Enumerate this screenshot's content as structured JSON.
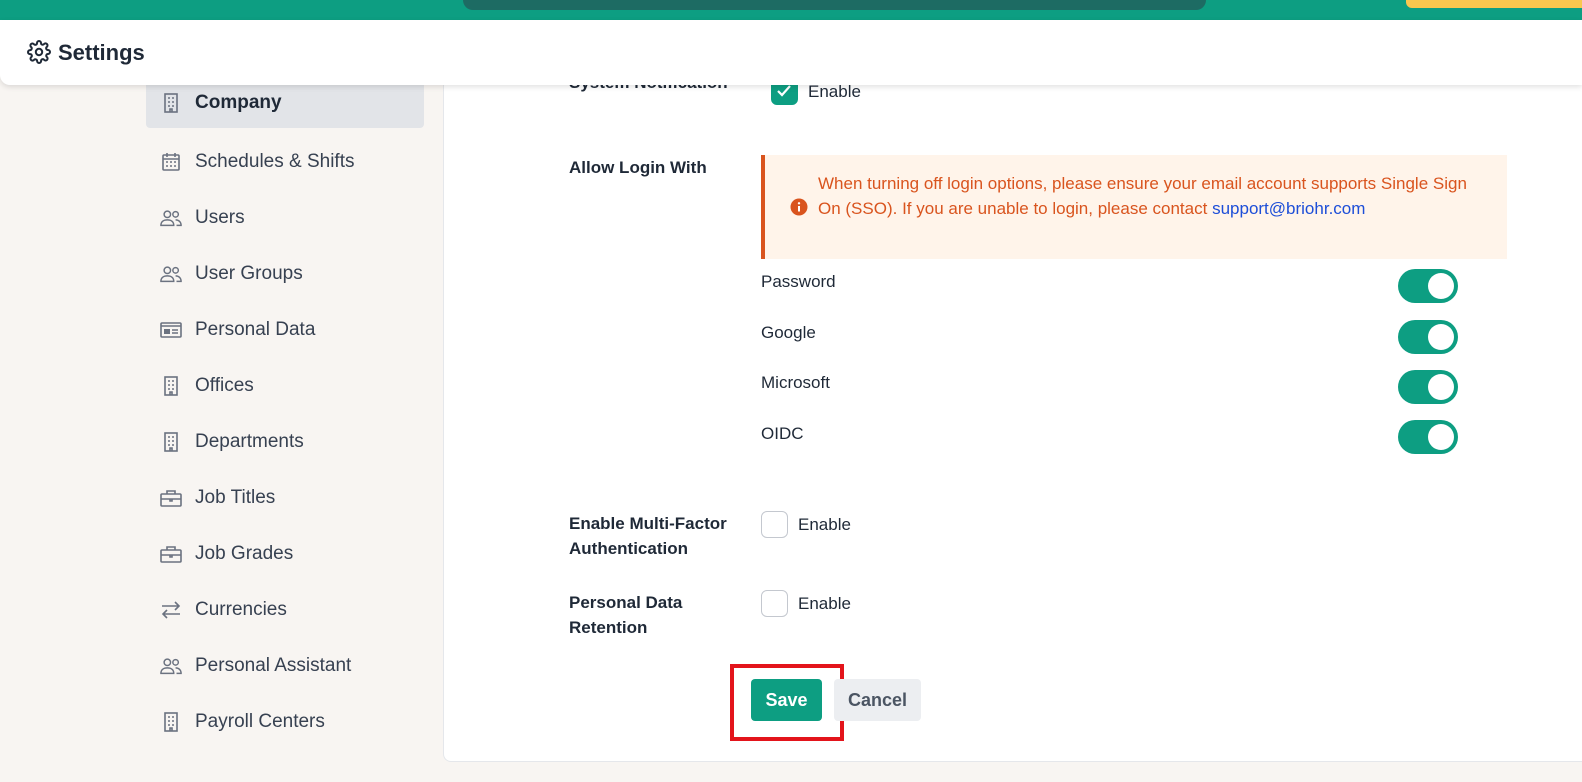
{
  "header": {
    "title": "Settings",
    "icon": "gear-icon"
  },
  "sidebar": {
    "items": [
      {
        "label": "Company",
        "icon": "building-icon",
        "active": true
      },
      {
        "label": "Schedules & Shifts",
        "icon": "calendar-icon"
      },
      {
        "label": "Users",
        "icon": "users-icon"
      },
      {
        "label": "User Groups",
        "icon": "users-icon"
      },
      {
        "label": "Personal Data",
        "icon": "id-card-icon"
      },
      {
        "label": "Offices",
        "icon": "building-icon"
      },
      {
        "label": "Departments",
        "icon": "building-icon"
      },
      {
        "label": "Job Titles",
        "icon": "briefcase-icon"
      },
      {
        "label": "Job Grades",
        "icon": "briefcase-icon"
      },
      {
        "label": "Currencies",
        "icon": "exchange-icon"
      },
      {
        "label": "Personal Assistant",
        "icon": "users-icon"
      },
      {
        "label": "Payroll Centers",
        "icon": "building-icon"
      }
    ]
  },
  "form": {
    "system_notification": {
      "label": "System Notification",
      "checkbox_label": "Enable",
      "checked": true
    },
    "allow_login": {
      "label": "Allow Login With",
      "alert": {
        "message": "When turning off login options, please ensure your email account supports Single Sign On (SSO). If you are unable to login, please contact",
        "link": "support@briohr.com"
      },
      "options": [
        {
          "label": "Password",
          "enabled": true
        },
        {
          "label": "Google",
          "enabled": true
        },
        {
          "label": "Microsoft",
          "enabled": true
        },
        {
          "label": "OIDC",
          "enabled": true
        }
      ]
    },
    "mfa": {
      "label_line1": "Enable Multi-Factor",
      "label_line2": "Authentication",
      "checkbox_label": "Enable",
      "checked": false
    },
    "retention": {
      "label_line1": "Personal Data",
      "label_line2": "Retention",
      "checkbox_label": "Enable",
      "checked": false
    }
  },
  "actions": {
    "save_label": "Save",
    "cancel_label": "Cancel"
  },
  "colors": {
    "accent": "#0d9e82",
    "alert_text": "#d9541e",
    "alert_bg": "#fff4ea",
    "highlight": "#e3141b"
  }
}
